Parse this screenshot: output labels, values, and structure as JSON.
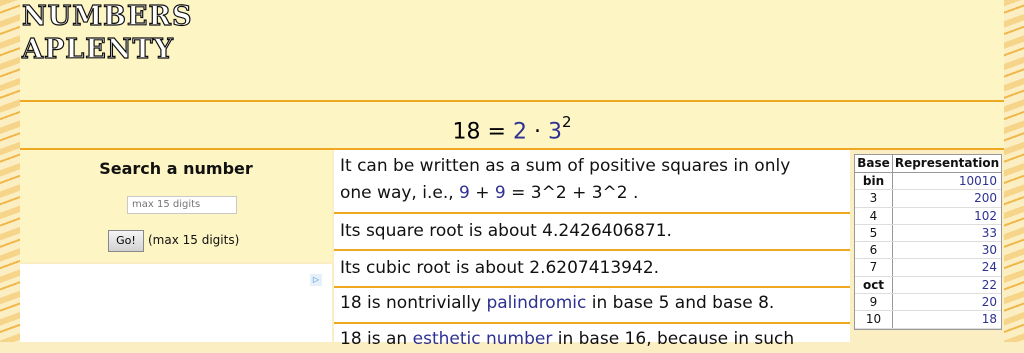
{
  "site": {
    "logo_line1": "NUMBERS",
    "logo_line2": "APLENTY"
  },
  "formula": {
    "number": "18",
    "eq": "=",
    "factor1": "2",
    "dot": "·",
    "factor2": "3",
    "exponent": "2"
  },
  "search": {
    "title": "Search a number",
    "placeholder": "max 15 digits",
    "go_label": "Go!",
    "note": "(max 15 digits)"
  },
  "ad": {
    "icon_label": "▷"
  },
  "facts": {
    "f1": {
      "line1": "It can be written as a sum of positive squares in only",
      "pre": "one way, i.e., ",
      "a": "9",
      "plus": " + ",
      "b": "9",
      "post": " = 3^2 + 3^2 ."
    },
    "f2": "Its square root is about 4.2426406871.",
    "f3": "Its cubic root is about 2.6207413942.",
    "f4": {
      "pre": "18 is nontrivially ",
      "link": "palindromic",
      "post": " in base 5 and base 8."
    },
    "f5": {
      "pre": "18 is an ",
      "link": "esthetic number",
      "post": " in base 16, because in such"
    }
  },
  "base_table": {
    "headers": {
      "base": "Base",
      "rep": "Representation"
    },
    "rows": [
      {
        "base": "bin",
        "rep": "10010"
      },
      {
        "base": "3",
        "rep": "200"
      },
      {
        "base": "4",
        "rep": "102"
      },
      {
        "base": "5",
        "rep": "33"
      },
      {
        "base": "6",
        "rep": "30"
      },
      {
        "base": "7",
        "rep": "24"
      },
      {
        "base": "oct",
        "rep": "22"
      },
      {
        "base": "9",
        "rep": "20"
      },
      {
        "base": "10",
        "rep": "18"
      }
    ]
  }
}
